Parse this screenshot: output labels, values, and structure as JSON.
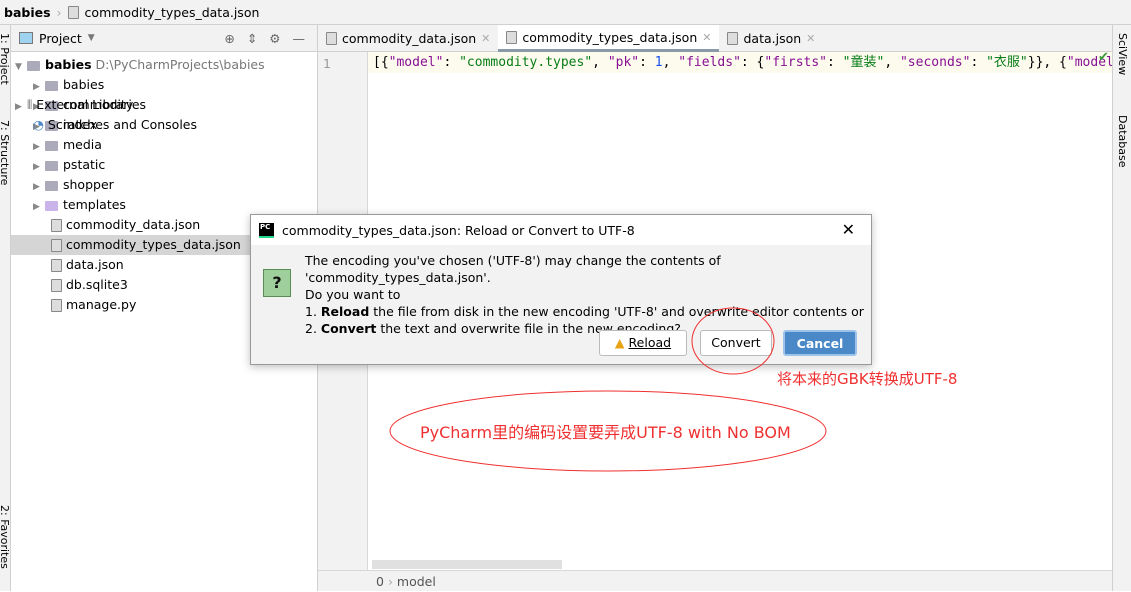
{
  "breadcrumb": {
    "project": "babies",
    "file": "commodity_types_data.json"
  },
  "left_strip": {
    "project": "1: Project",
    "structure": "7: Structure",
    "favorites": "2: Favorites"
  },
  "project_panel": {
    "title": "Project",
    "root": {
      "name": "babies",
      "path": "D:\\PyCharmProjects\\babies"
    },
    "items": [
      {
        "label": "babies",
        "type": "folder"
      },
      {
        "label": "commodity",
        "type": "folder"
      },
      {
        "label": "index",
        "type": "folder"
      },
      {
        "label": "media",
        "type": "folder"
      },
      {
        "label": "pstatic",
        "type": "folder"
      },
      {
        "label": "shopper",
        "type": "folder"
      },
      {
        "label": "templates",
        "type": "folder"
      },
      {
        "label": "commodity_data.json",
        "type": "file"
      },
      {
        "label": "commodity_types_data.json",
        "type": "file",
        "selected": true
      },
      {
        "label": "data.json",
        "type": "file"
      },
      {
        "label": "db.sqlite3",
        "type": "file"
      },
      {
        "label": "manage.py",
        "type": "file"
      }
    ],
    "external": "External Libraries",
    "scratches": "Scratches and Consoles"
  },
  "tabs": [
    {
      "label": "commodity_data.json"
    },
    {
      "label": "commodity_types_data.json",
      "active": true
    },
    {
      "label": "data.json"
    }
  ],
  "editor": {
    "line_number": "1",
    "code": {
      "p1": "[{",
      "k1": "\"model\"",
      "p2": ": ",
      "s1": "\"commodity.types\"",
      "p3": ", ",
      "k2": "\"pk\"",
      "p4": ": ",
      "n1": "1",
      "p5": ", ",
      "k3": "\"fields\"",
      "p6": ": {",
      "k4": "\"firsts\"",
      "p7": ": ",
      "s2": "\"童装\"",
      "p8": ", ",
      "k5": "\"seconds\"",
      "p9": ": ",
      "s3": "\"衣服\"",
      "p10": "}}, {",
      "k6": "\"model"
    }
  },
  "status": {
    "pos": "0",
    "path": "model"
  },
  "right_strip": {
    "sciview": "SciView",
    "database": "Database"
  },
  "dialog": {
    "title": "commodity_types_data.json: Reload or Convert to UTF-8",
    "line1": "The encoding you've chosen ('UTF-8') may change the contents of 'commodity_types_data.json'.",
    "line2": "Do you want to",
    "line3_num": "1. ",
    "line3_bold": "Reload",
    "line3_rest": " the file from disk in the new encoding 'UTF-8' and overwrite editor contents or",
    "line4_num": "2. ",
    "line4_bold": "Convert",
    "line4_rest": " the text and overwrite file in the new encoding?",
    "reload": "Reload",
    "convert": "Convert",
    "cancel": "Cancel"
  },
  "annotations": {
    "convert_note": "将本来的GBK转换成UTF-8",
    "encoding_note": "PyCharm里的编码设置要弄成UTF-8 with No BOM",
    "color": "#f03030"
  }
}
